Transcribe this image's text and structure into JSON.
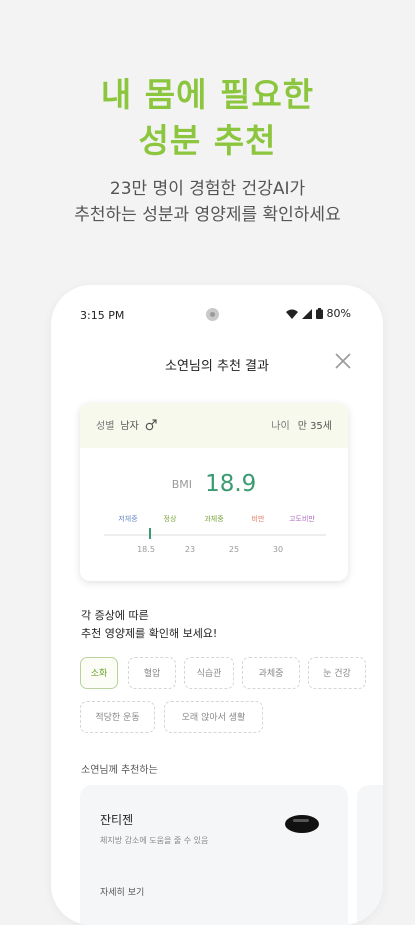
{
  "promo": {
    "headline_line1": "내 몸에 필요한",
    "headline_line2": "성분 추천",
    "sub_line1": "23만 명이 경험한 건강AI가",
    "sub_line2": "추천하는 성분과 영양제를 확인하세요"
  },
  "status_bar": {
    "time": "3:15 PM",
    "battery": "80%",
    "icons": [
      "wifi-icon",
      "signal-icon",
      "battery-icon"
    ]
  },
  "header": {
    "title": "소연님의 추천 결과",
    "close_icon": "close-icon"
  },
  "profile": {
    "gender_label": "성별",
    "gender_value": "남자",
    "gender_icon": "male-icon",
    "age_label": "나이",
    "age_value": "만 35세",
    "bmi_label": "BMI",
    "bmi_value": "18.9",
    "bmi_value_num": 18.9,
    "scale_categories": [
      {
        "label": "저체중",
        "color": "#6b8fc9"
      },
      {
        "label": "정상",
        "color": "#7aa33f"
      },
      {
        "label": "과체중",
        "color": "#7aa33f"
      },
      {
        "label": "비만",
        "color": "#e2795f"
      },
      {
        "label": "고도비만",
        "color": "#b06fc3"
      }
    ],
    "scale_ticks": [
      "18.5",
      "23",
      "25",
      "30"
    ],
    "accent_color": "#3a9b71"
  },
  "symptom_prompt": {
    "line1": "각 증상에 따른",
    "line2": "추천 영양제를 확인해 보세요!"
  },
  "chips": [
    {
      "label": "소화",
      "selected": true
    },
    {
      "label": "혈압",
      "selected": false
    },
    {
      "label": "식습관",
      "selected": false
    },
    {
      "label": "과체중",
      "selected": false
    },
    {
      "label": "눈 건강",
      "selected": false
    },
    {
      "label": "적당한 운동",
      "selected": false
    },
    {
      "label": "오래 앉아서 생활",
      "selected": false
    }
  ],
  "recommendation": {
    "section_label": "소연님께 추천하는",
    "name": "잔티젠",
    "description": "체지방 감소에 도움을 줄 수 있음",
    "more_label": "자세히 보기",
    "pill_icon": "pill-icon"
  },
  "colors": {
    "brand_green": "#8cc63f",
    "bmi_green": "#3a9b71",
    "background": "#f3f3f3"
  }
}
